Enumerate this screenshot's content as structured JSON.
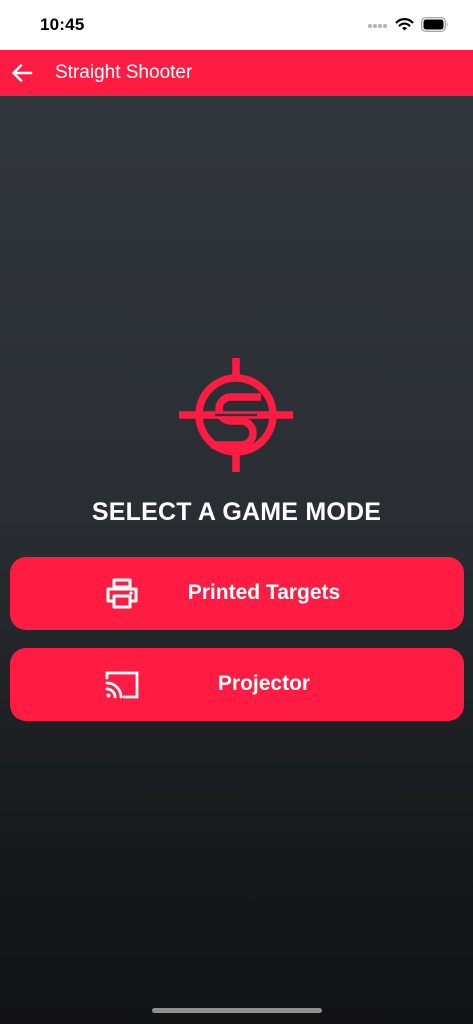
{
  "status_bar": {
    "time": "10:45"
  },
  "app_bar": {
    "title": "Straight Shooter",
    "back_icon": "arrow-left-icon"
  },
  "main": {
    "logo_icon": "crosshair-s-logo",
    "heading": "SELECT A GAME MODE",
    "modes": [
      {
        "label": "Printed Targets",
        "icon": "printer-icon"
      },
      {
        "label": "Projector",
        "icon": "cast-icon"
      }
    ]
  },
  "colors": {
    "accent": "#ff1c43",
    "background_top": "#31363c",
    "background_bottom": "#111213",
    "text": "#ffffff"
  }
}
